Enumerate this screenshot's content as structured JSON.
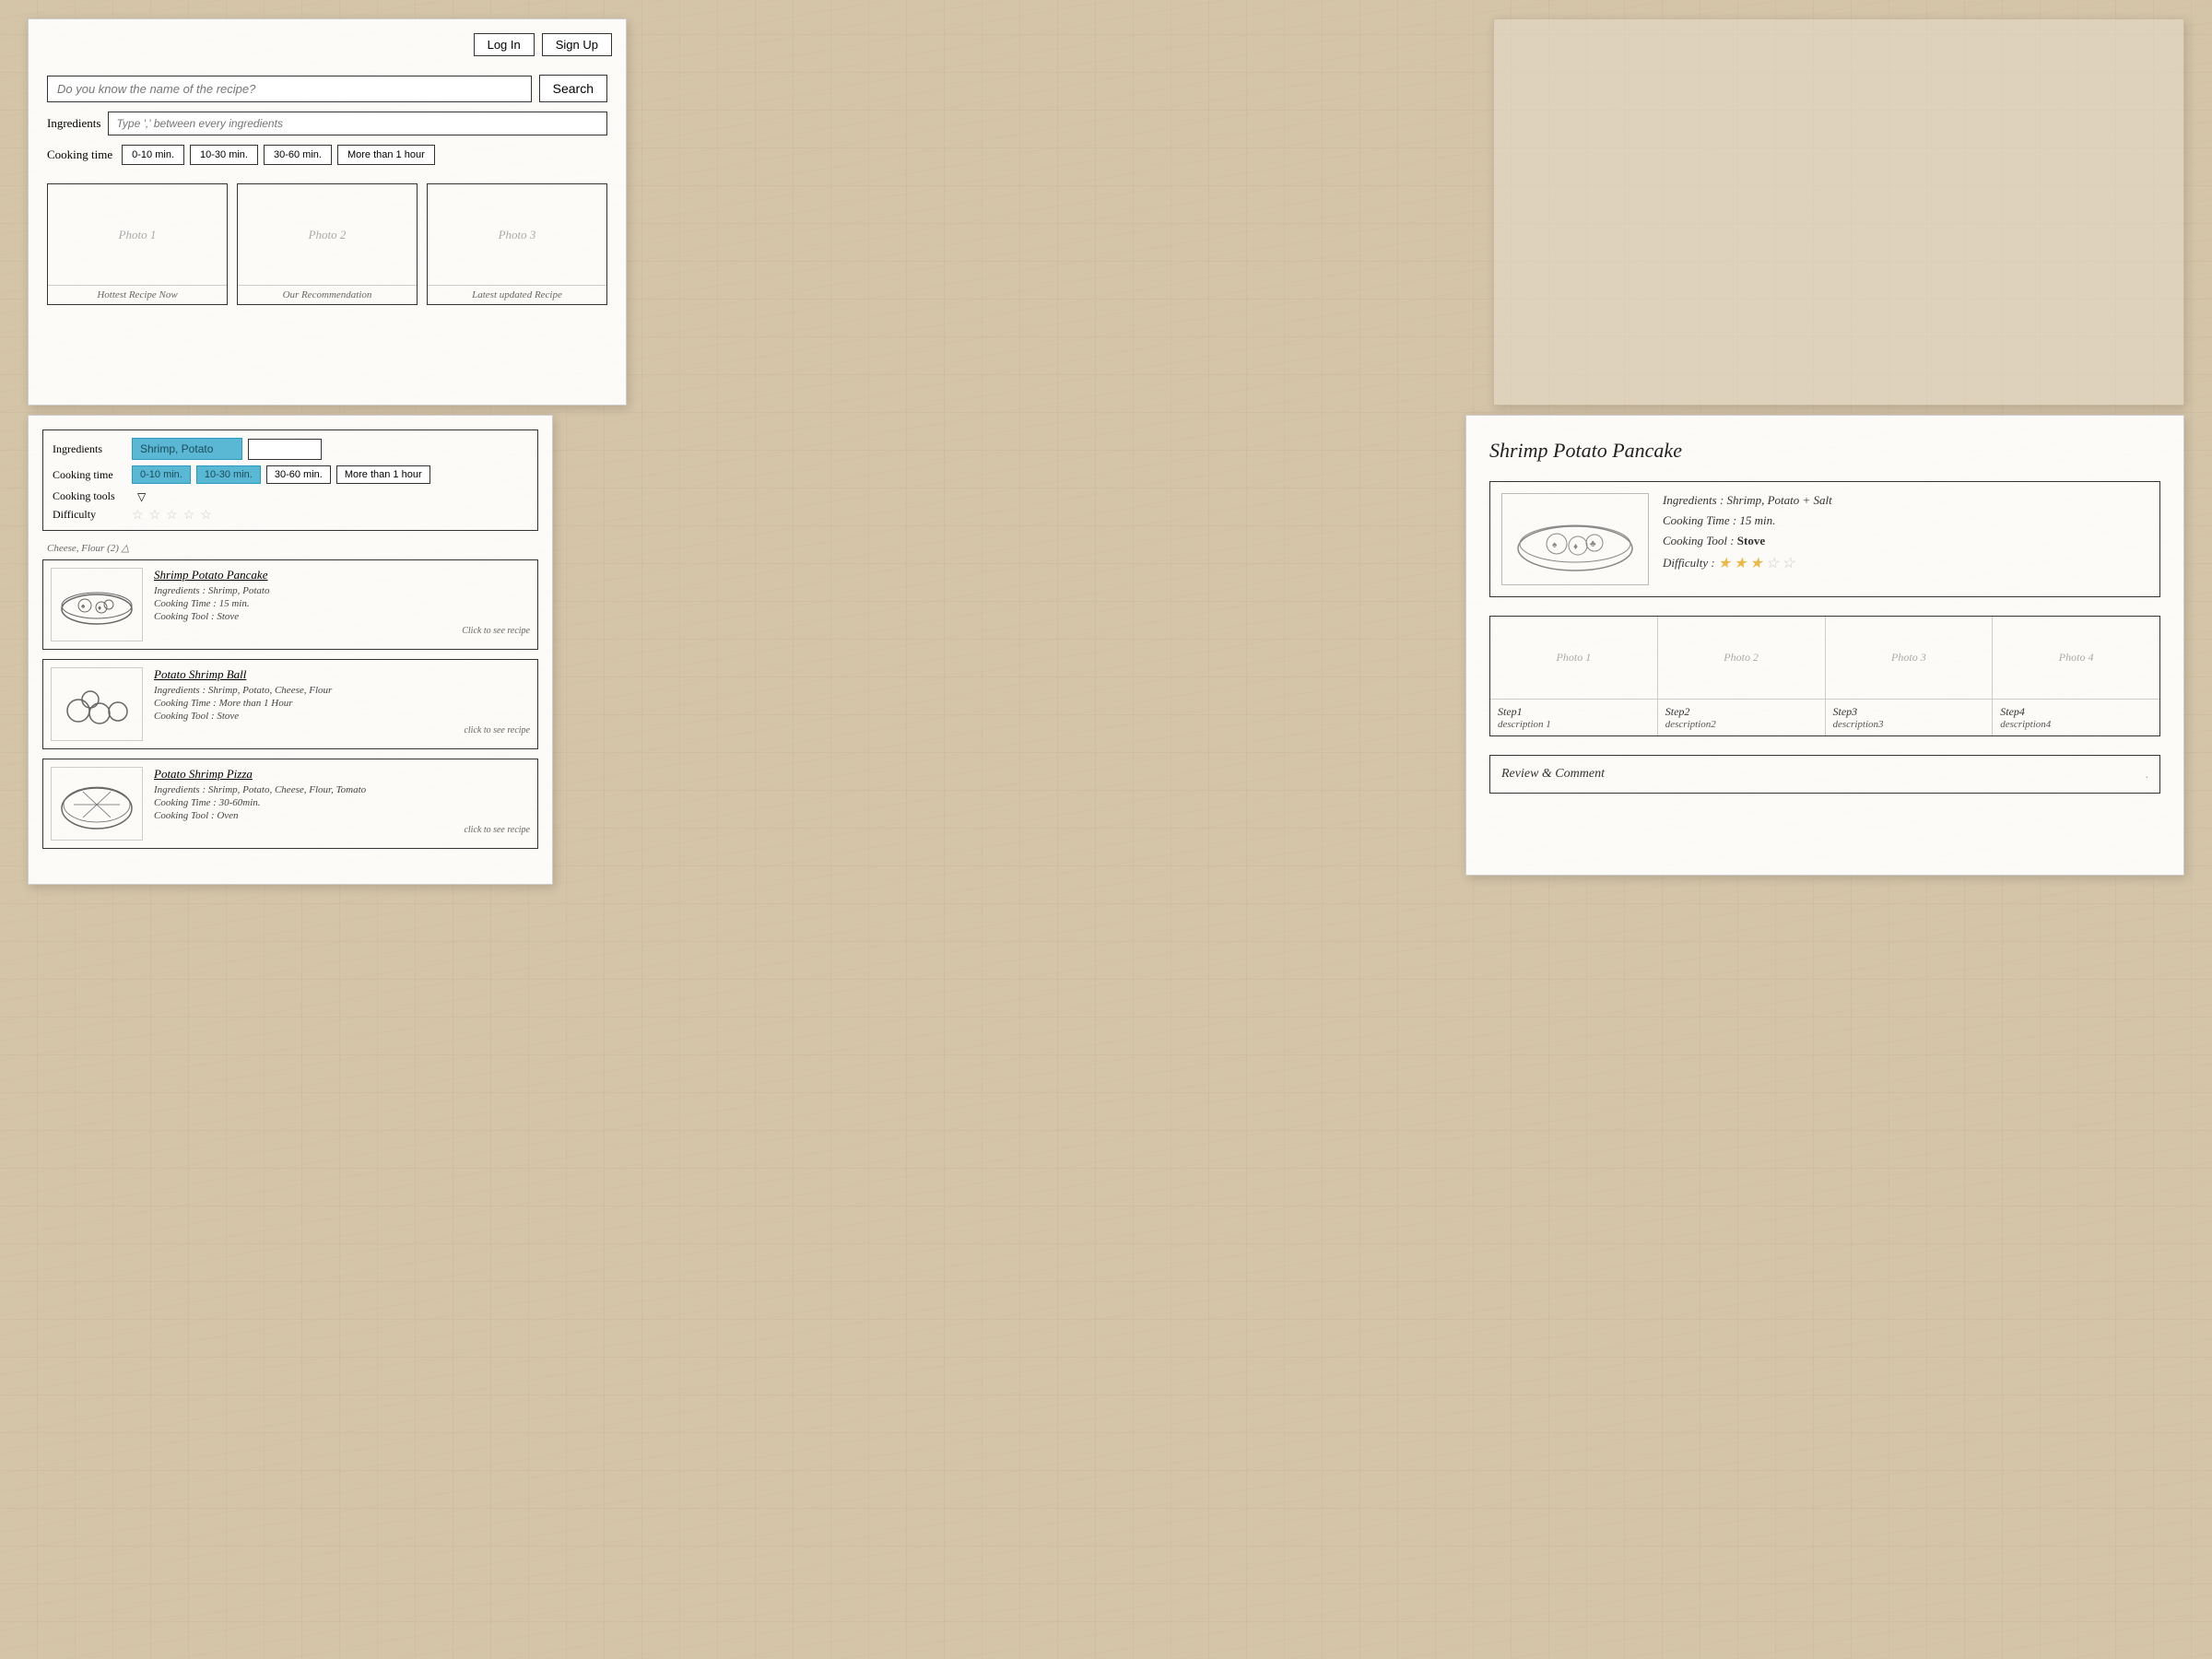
{
  "topLeft": {
    "buttons": {
      "login": "Log In",
      "signup": "Sign Up"
    },
    "searchInput": {
      "placeholder": "Do you know the name of the recipe?",
      "searchBtn": "Search"
    },
    "ingredientsInput": {
      "label": "Ingredients",
      "placeholder": "Type ',' between every ingredients"
    },
    "cookingTime": {
      "label": "Cooking time",
      "options": [
        "0-10 min.",
        "10-30 min.",
        "30-60 min.",
        "More than 1 hour"
      ]
    },
    "photos": [
      {
        "label": "Photo 1",
        "caption": "Hottest Recipe Now"
      },
      {
        "label": "Photo 2",
        "caption": "Our Recommendation"
      },
      {
        "label": "Photo 3",
        "caption": "Latest updated Recipe"
      }
    ]
  },
  "bottomLeft": {
    "ingredients": {
      "label": "Ingredients",
      "value": "Shrimp, Potato"
    },
    "cookingTime": {
      "label": "Cooking time",
      "options": [
        "0-10 min.",
        "10-30 min.",
        "30-60 min.",
        "More than 1 hour"
      ],
      "active": [
        0,
        1
      ]
    },
    "cookingTools": {
      "label": "Cooking tools"
    },
    "difficulty": {
      "label": "Difficulty",
      "stars": 5
    },
    "warning": "Cheese, Flour (2) △",
    "recipes": [
      {
        "title": "Shrimp Potato Pancake",
        "ingredients": "Ingredients : Shrimp, Potato",
        "cookingTime": "Cooking Time : 15 min.",
        "cookingTool": "Cooking Tool : Stove",
        "clickText": "Click to see recipe"
      },
      {
        "title": "Potato Shrimp Ball",
        "ingredients": "Ingredients : Shrimp, Potato, Cheese, Flour",
        "cookingTime": "Cooking Time : More than 1 Hour",
        "cookingTool": "Cooking Tool : Stove",
        "clickText": "click to see recipe"
      },
      {
        "title": "Potato Shrimp Pizza",
        "ingredients": "Ingredients : Shrimp, Potato, Cheese, Flour, Tomato",
        "cookingTime": "Cooking Time : 30-60min.",
        "cookingTool": "Cooking Tool : Oven",
        "clickText": "click to see recipe"
      }
    ]
  },
  "bottomRight": {
    "title": "Shrimp Potato Pancake",
    "recipeCard": {
      "ingredients": "Ingredients : Shrimp, Potato + Salt",
      "cookingTime": "Cooking Time : 15 min.",
      "cookingTool": "Cooking Tool : Stove",
      "difficulty": "Difficulty :",
      "stars": [
        true,
        true,
        true,
        false,
        false
      ]
    },
    "steps": [
      {
        "photo": "Photo 1",
        "stepLabel": "Step1",
        "desc": "description 1"
      },
      {
        "photo": "Photo 2",
        "stepLabel": "Step2",
        "desc": "description2"
      },
      {
        "photo": "Photo 3",
        "stepLabel": "Step3",
        "desc": "description3"
      },
      {
        "photo": "Photo 4",
        "stepLabel": "Step4",
        "desc": "description4"
      }
    ],
    "review": {
      "title": "Review & Comment",
      "placeholder": "."
    }
  }
}
